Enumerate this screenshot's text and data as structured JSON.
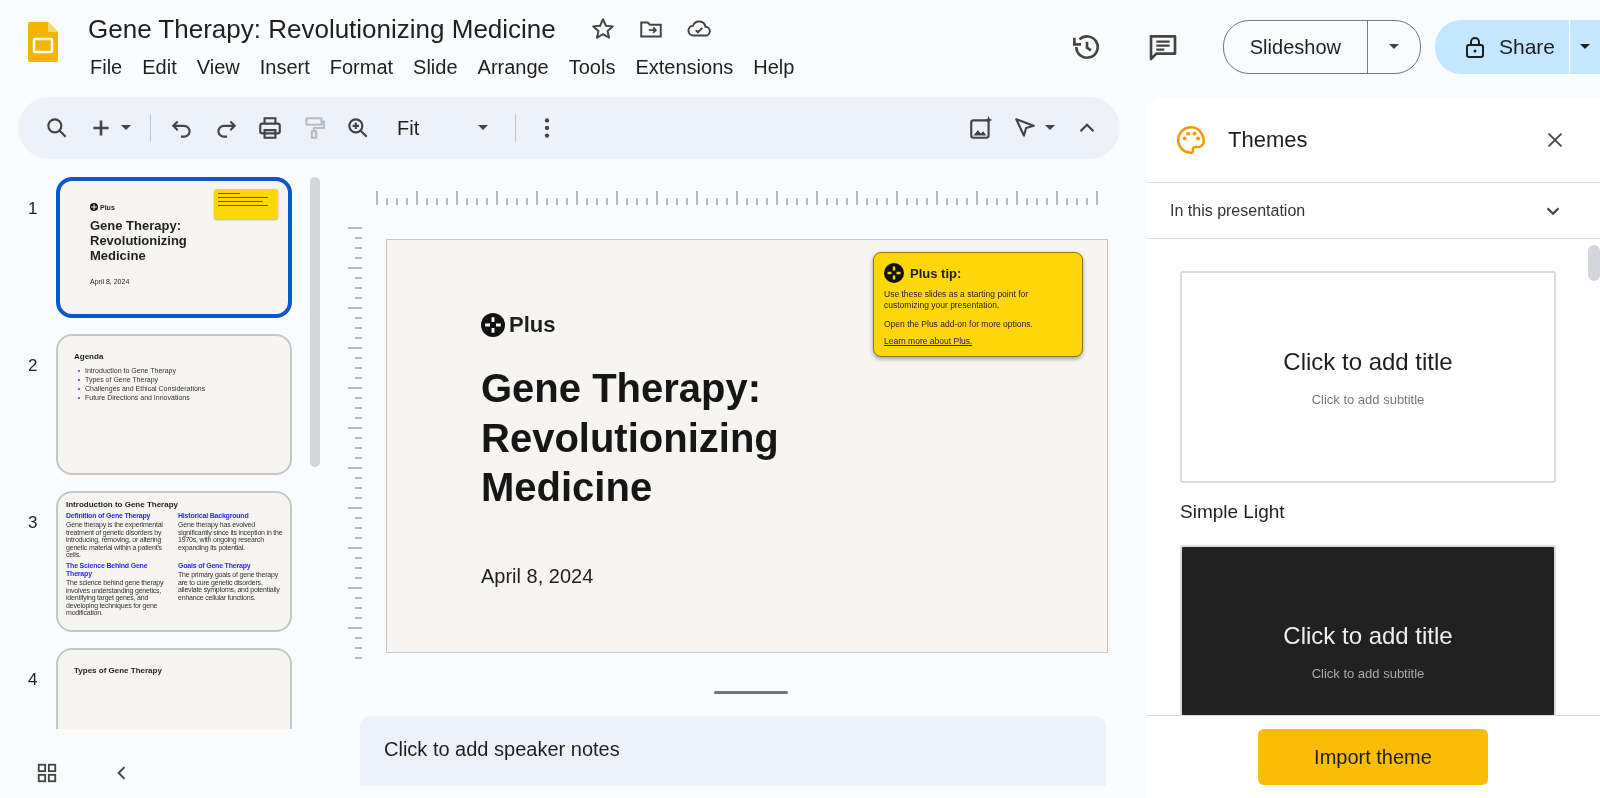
{
  "document": {
    "title": "Gene Therapy: Revolutionizing Medicine"
  },
  "menu": [
    "File",
    "Edit",
    "View",
    "Insert",
    "Format",
    "Slide",
    "Arrange",
    "Tools",
    "Extensions",
    "Help"
  ],
  "header_buttons": {
    "slideshow": "Slideshow",
    "share": "Share"
  },
  "toolbar": {
    "zoom_value": "Fit",
    "format_painter": {
      "disabled": true
    }
  },
  "slides": [
    {
      "number": "1",
      "selected": true,
      "kind": "title",
      "logo": "Plus",
      "title": "Gene Therapy: Revolutionizing Medicine",
      "date": "April 8, 2024"
    },
    {
      "number": "2",
      "selected": false,
      "kind": "agenda",
      "title": "Agenda",
      "bullets": [
        "Introduction to Gene Therapy",
        "Types of Gene Therapy",
        "Challenges and Ethical Considerations",
        "Future Directions and Innovations"
      ]
    },
    {
      "number": "3",
      "selected": false,
      "kind": "sections",
      "title": "Introduction to Gene Therapy",
      "sections": [
        {
          "heading": "Definition of Gene Therapy",
          "body": "Gene therapy is the experimental treatment of genetic disorders by introducing, removing, or altering genetic material within a patient's cells."
        },
        {
          "heading": "Historical Background",
          "body": "Gene therapy has evolved significantly since its inception in the 1970s, with ongoing research expanding its potential."
        },
        {
          "heading": "The Science Behind Gene Therapy",
          "body": "The science behind gene therapy involves understanding genetics, identifying target genes, and developing techniques for gene modification."
        },
        {
          "heading": "Goals of Gene Therapy",
          "body": "The primary goals of gene therapy are to cure genetic disorders, alleviate symptoms, and potentially enhance cellular functions."
        }
      ]
    },
    {
      "number": "4",
      "selected": false,
      "kind": "heading",
      "title": "Types of Gene Therapy"
    }
  ],
  "current_slide": {
    "logo": "Plus",
    "title": "Gene Therapy: Revolutionizing Medicine",
    "date": "April 8, 2024",
    "tip": {
      "title": "Plus tip:",
      "body": "Use these slides as a starting point for customizing your presentation.",
      "body2": "Open the Plus add-on for more options.",
      "link": "Learn more about Plus."
    }
  },
  "speaker_notes": {
    "placeholder": "Click to add speaker notes"
  },
  "themes_panel": {
    "title": "Themes",
    "section": "In this presentation",
    "expanded": true,
    "themes": [
      {
        "kind": "light",
        "title": "Click to add title",
        "subtitle": "Click to add subtitle",
        "name": "Simple Light"
      },
      {
        "kind": "dark",
        "title": "Click to add title",
        "subtitle": "Click to add subtitle"
      }
    ],
    "import_button": "Import theme"
  }
}
